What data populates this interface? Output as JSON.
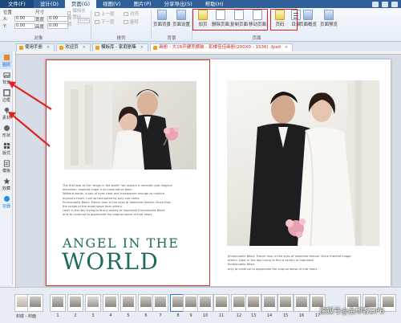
{
  "menubar": {
    "items": [
      "文件(F)",
      "设计(D)",
      "页面(G)",
      "视图(V)",
      "图片(P)",
      "分享导出(S)",
      "帮助(H)"
    ]
  },
  "ribbon": {
    "position_label": "位置",
    "size_label": "尺寸",
    "x_label": "X:",
    "y_label": "Y:",
    "width_label": "宽度",
    "height_label": "高度",
    "x_value": "0.00",
    "y_value": "0.00",
    "width_value": "0.00",
    "height_value": "0.00",
    "keep_ratio_label": "保持长宽比",
    "rotate_label": "旋转",
    "rotate_value": "0.00",
    "group_object": "对象",
    "up_one": "上一层",
    "down_one": "下一层",
    "align": "对齐",
    "rotate": "旋转",
    "group_arrange": "排列",
    "page_bg": "页面背景",
    "page_settings": "页面设置",
    "group_canvas": "背景",
    "add": "加页",
    "delete_page": "删除页面",
    "copy_page": "复制页面",
    "move_page": "移动页面",
    "page_number": "页码",
    "toc": "目录",
    "page_overview": "页面概览",
    "page_preview": "页面预览",
    "group_page": "页面"
  },
  "tabs": [
    {
      "label": "使用手册"
    },
    {
      "label": "欢迎页"
    },
    {
      "label": "模板库 - 家庭剧集"
    },
    {
      "label": "画册 - 大16开硬壳横装 - 影楼佳佳画册(200X0 - 1536) .fpsd"
    }
  ],
  "lefttools": [
    {
      "label": "图层"
    },
    {
      "label": "背景"
    },
    {
      "label": "边框"
    },
    {
      "label": "素材"
    },
    {
      "label": "形状"
    },
    {
      "label": "版式"
    },
    {
      "label": "模板"
    },
    {
      "label": "收藏"
    },
    {
      "label": "容器"
    }
  ],
  "page": {
    "left_text": "The  first  look  at  the  \"angel  in  the  world  \"we  acquire  a  romantic  plot  magical\nattraction. Inspired angel is so close we've been\nWithout words, a pair of eyes clear and transparent enough to capture\nanyone's heart. I am so fascinated by only one name\nEmmanuelle Béart. French man in the eyes of Valentine forever. Since then\nthe image of the angel stays from others.\nLater in the day trying to find a variety of imprinted Emmanuelle Béart\nonly to continue to appreciate the original sense of that heart.",
    "title_line1": "ANGEL IN THE",
    "title_line2": "WORLD",
    "right_text": "Emmanuelle Béart. French man in the eyes of Valentine forever. Since thenthe image\nothers.  Later in the day trying to find a variety of imprinted\nEmmanuelle Béart\nonly to continue to appreciate the original sense of that heart."
  },
  "filmstrip": {
    "cover_label": "封底 - 封面",
    "numbers": [
      "1",
      "2",
      "3",
      "4",
      "5",
      "6",
      "7",
      "8",
      "9",
      "10",
      "11",
      "12",
      "13",
      "14",
      "15",
      "16",
      "17"
    ],
    "watermark": "搜狐号@金印客DPB"
  },
  "colors": {
    "menubar": "#2f5f98",
    "highlight": "#e02222",
    "title": "#1f6b5e",
    "selected_thumb": "#2b76d2"
  }
}
